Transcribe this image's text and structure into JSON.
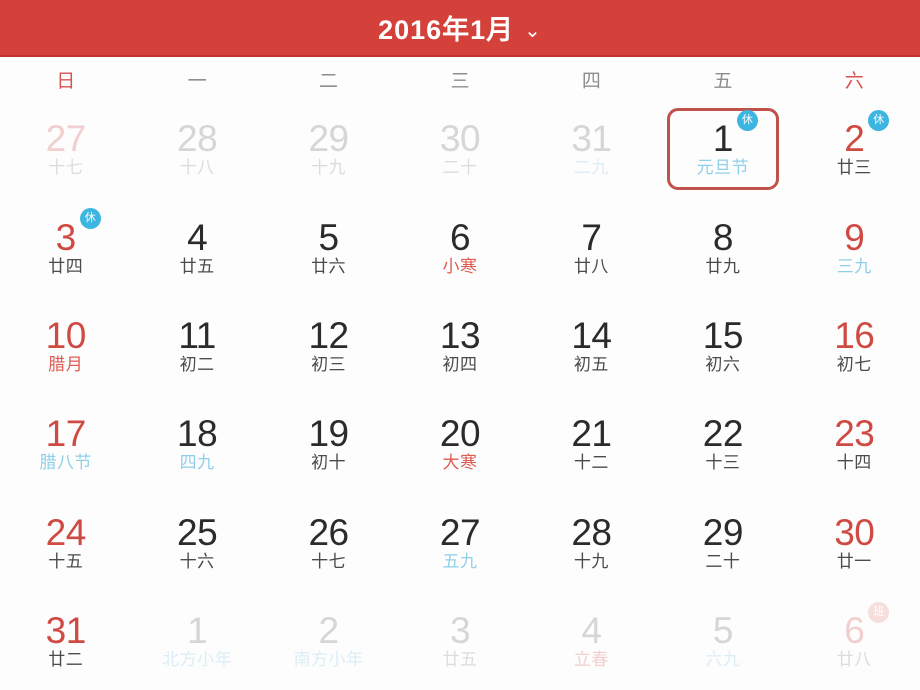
{
  "header": {
    "title": "2016年1月",
    "chevron": "⌄",
    "bg_color": "#d4403a"
  },
  "weekdays": [
    {
      "label": "日",
      "weekend": true
    },
    {
      "label": "一",
      "weekend": false
    },
    {
      "label": "二",
      "weekend": false
    },
    {
      "label": "三",
      "weekend": false
    },
    {
      "label": "四",
      "weekend": false
    },
    {
      "label": "五",
      "weekend": false
    },
    {
      "label": "六",
      "weekend": true
    }
  ],
  "colors": {
    "header_red": "#d4403a",
    "weekend_red": "#cf4a42",
    "lunar_red": "#e05b52",
    "lunar_blue": "#8fd0e8",
    "rest_badge_blue": "#3cb6e0",
    "work_badge_pink": "#f3c9c6",
    "selected_border": "#c0524c"
  },
  "days": [
    {
      "num": "27",
      "lunar": "十七",
      "num_color": "red",
      "lunar_color": "dark",
      "out": true,
      "selected": false,
      "badge": ""
    },
    {
      "num": "28",
      "lunar": "十八",
      "num_color": "dark",
      "lunar_color": "dark",
      "out": true,
      "selected": false,
      "badge": ""
    },
    {
      "num": "29",
      "lunar": "十九",
      "num_color": "dark",
      "lunar_color": "dark",
      "out": true,
      "selected": false,
      "badge": ""
    },
    {
      "num": "30",
      "lunar": "二十",
      "num_color": "dark",
      "lunar_color": "dark",
      "out": true,
      "selected": false,
      "badge": ""
    },
    {
      "num": "31",
      "lunar": "二九",
      "num_color": "dark",
      "lunar_color": "blue",
      "out": true,
      "selected": false,
      "badge": ""
    },
    {
      "num": "1",
      "lunar": "元旦节",
      "num_color": "dark",
      "lunar_color": "blue",
      "out": false,
      "selected": true,
      "badge": "休"
    },
    {
      "num": "2",
      "lunar": "廿三",
      "num_color": "red",
      "lunar_color": "dark",
      "out": false,
      "selected": false,
      "badge": "休"
    },
    {
      "num": "3",
      "lunar": "廿四",
      "num_color": "red",
      "lunar_color": "dark",
      "out": false,
      "selected": false,
      "badge": "休"
    },
    {
      "num": "4",
      "lunar": "廿五",
      "num_color": "dark",
      "lunar_color": "dark",
      "out": false,
      "selected": false,
      "badge": ""
    },
    {
      "num": "5",
      "lunar": "廿六",
      "num_color": "dark",
      "lunar_color": "dark",
      "out": false,
      "selected": false,
      "badge": ""
    },
    {
      "num": "6",
      "lunar": "小寒",
      "num_color": "dark",
      "lunar_color": "red",
      "out": false,
      "selected": false,
      "badge": ""
    },
    {
      "num": "7",
      "lunar": "廿八",
      "num_color": "dark",
      "lunar_color": "dark",
      "out": false,
      "selected": false,
      "badge": ""
    },
    {
      "num": "8",
      "lunar": "廿九",
      "num_color": "dark",
      "lunar_color": "dark",
      "out": false,
      "selected": false,
      "badge": ""
    },
    {
      "num": "9",
      "lunar": "三九",
      "num_color": "red",
      "lunar_color": "blue",
      "out": false,
      "selected": false,
      "badge": ""
    },
    {
      "num": "10",
      "lunar": "腊月",
      "num_color": "red",
      "lunar_color": "red",
      "out": false,
      "selected": false,
      "badge": ""
    },
    {
      "num": "11",
      "lunar": "初二",
      "num_color": "dark",
      "lunar_color": "dark",
      "out": false,
      "selected": false,
      "badge": ""
    },
    {
      "num": "12",
      "lunar": "初三",
      "num_color": "dark",
      "lunar_color": "dark",
      "out": false,
      "selected": false,
      "badge": ""
    },
    {
      "num": "13",
      "lunar": "初四",
      "num_color": "dark",
      "lunar_color": "dark",
      "out": false,
      "selected": false,
      "badge": ""
    },
    {
      "num": "14",
      "lunar": "初五",
      "num_color": "dark",
      "lunar_color": "dark",
      "out": false,
      "selected": false,
      "badge": ""
    },
    {
      "num": "15",
      "lunar": "初六",
      "num_color": "dark",
      "lunar_color": "dark",
      "out": false,
      "selected": false,
      "badge": ""
    },
    {
      "num": "16",
      "lunar": "初七",
      "num_color": "red",
      "lunar_color": "dark",
      "out": false,
      "selected": false,
      "badge": ""
    },
    {
      "num": "17",
      "lunar": "腊八节",
      "num_color": "red",
      "lunar_color": "blue",
      "out": false,
      "selected": false,
      "badge": ""
    },
    {
      "num": "18",
      "lunar": "四九",
      "num_color": "dark",
      "lunar_color": "blue",
      "out": false,
      "selected": false,
      "badge": ""
    },
    {
      "num": "19",
      "lunar": "初十",
      "num_color": "dark",
      "lunar_color": "dark",
      "out": false,
      "selected": false,
      "badge": ""
    },
    {
      "num": "20",
      "lunar": "大寒",
      "num_color": "dark",
      "lunar_color": "red",
      "out": false,
      "selected": false,
      "badge": ""
    },
    {
      "num": "21",
      "lunar": "十二",
      "num_color": "dark",
      "lunar_color": "dark",
      "out": false,
      "selected": false,
      "badge": ""
    },
    {
      "num": "22",
      "lunar": "十三",
      "num_color": "dark",
      "lunar_color": "dark",
      "out": false,
      "selected": false,
      "badge": ""
    },
    {
      "num": "23",
      "lunar": "十四",
      "num_color": "red",
      "lunar_color": "dark",
      "out": false,
      "selected": false,
      "badge": ""
    },
    {
      "num": "24",
      "lunar": "十五",
      "num_color": "red",
      "lunar_color": "dark",
      "out": false,
      "selected": false,
      "badge": ""
    },
    {
      "num": "25",
      "lunar": "十六",
      "num_color": "dark",
      "lunar_color": "dark",
      "out": false,
      "selected": false,
      "badge": ""
    },
    {
      "num": "26",
      "lunar": "十七",
      "num_color": "dark",
      "lunar_color": "dark",
      "out": false,
      "selected": false,
      "badge": ""
    },
    {
      "num": "27",
      "lunar": "五九",
      "num_color": "dark",
      "lunar_color": "blue",
      "out": false,
      "selected": false,
      "badge": ""
    },
    {
      "num": "28",
      "lunar": "十九",
      "num_color": "dark",
      "lunar_color": "dark",
      "out": false,
      "selected": false,
      "badge": ""
    },
    {
      "num": "29",
      "lunar": "二十",
      "num_color": "dark",
      "lunar_color": "dark",
      "out": false,
      "selected": false,
      "badge": ""
    },
    {
      "num": "30",
      "lunar": "廿一",
      "num_color": "red",
      "lunar_color": "dark",
      "out": false,
      "selected": false,
      "badge": ""
    },
    {
      "num": "31",
      "lunar": "廿二",
      "num_color": "red",
      "lunar_color": "dark",
      "out": false,
      "selected": false,
      "badge": ""
    },
    {
      "num": "1",
      "lunar": "北方小年",
      "num_color": "dark",
      "lunar_color": "blue",
      "out": true,
      "selected": false,
      "badge": ""
    },
    {
      "num": "2",
      "lunar": "南方小年",
      "num_color": "dark",
      "lunar_color": "blue",
      "out": true,
      "selected": false,
      "badge": ""
    },
    {
      "num": "3",
      "lunar": "廿五",
      "num_color": "dark",
      "lunar_color": "dark",
      "out": true,
      "selected": false,
      "badge": ""
    },
    {
      "num": "4",
      "lunar": "立春",
      "num_color": "dark",
      "lunar_color": "red",
      "out": true,
      "selected": false,
      "badge": ""
    },
    {
      "num": "5",
      "lunar": "六九",
      "num_color": "dark",
      "lunar_color": "blue",
      "out": true,
      "selected": false,
      "badge": ""
    },
    {
      "num": "6",
      "lunar": "廿八",
      "num_color": "red",
      "lunar_color": "dark",
      "out": true,
      "selected": false,
      "badge": "班"
    }
  ]
}
